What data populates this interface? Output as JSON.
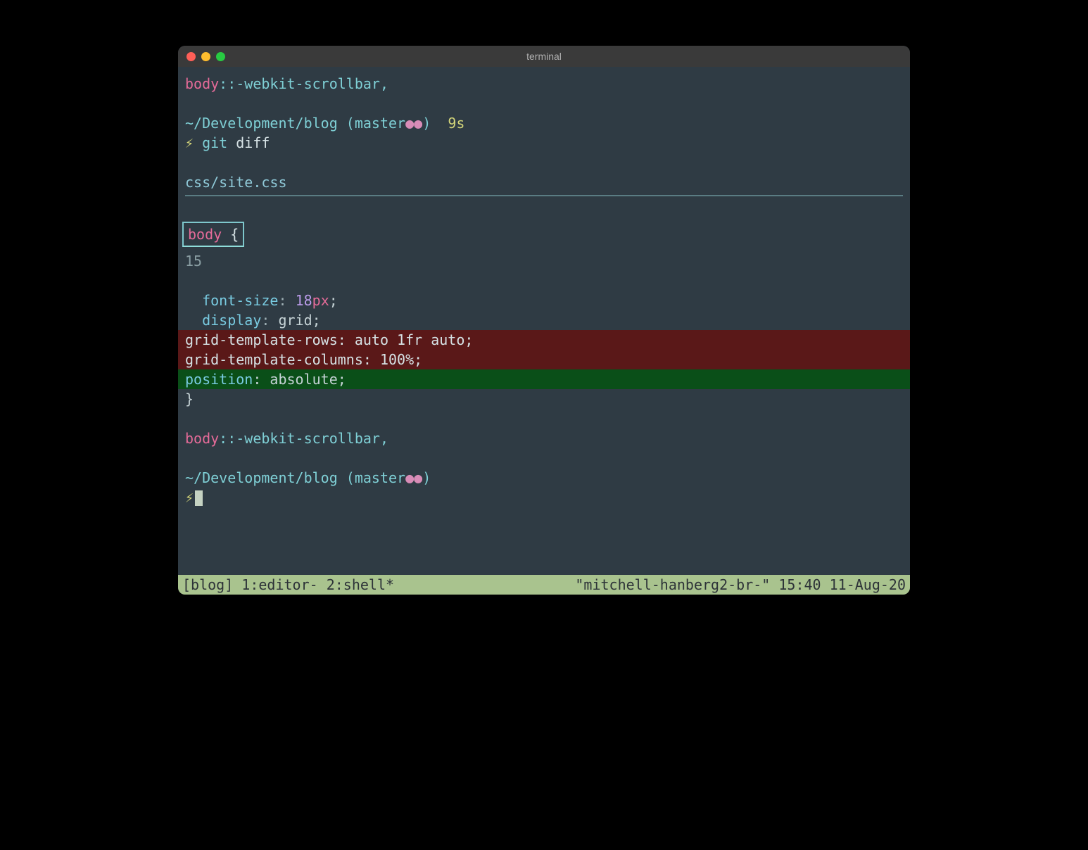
{
  "window": {
    "title": "terminal"
  },
  "output": {
    "line1_a": "body",
    "line1_b": "::-webkit-scrollbar,",
    "prompt_path": "~/Development/blog",
    "prompt_branch_open": " (",
    "prompt_branch": "master",
    "prompt_dots": "●●",
    "prompt_branch_close": ")",
    "prompt_time": "  9s",
    "prompt_sym": "⚡",
    "cmd_git": " git",
    "cmd_diff": " diff",
    "diff_file": "css/site.css",
    "hunk_body": "body ",
    "hunk_brace": "{",
    "line_num": "15",
    "ctx1_prop": "font-size",
    "ctx1_colon": ": ",
    "ctx1_num": "18",
    "ctx1_unit": "px",
    "ctx1_semi": ";",
    "ctx2_prop": "display",
    "ctx2_colon": ": ",
    "ctx2_val": "grid",
    "ctx2_semi": ";",
    "del1": "  grid-template-rows: auto 1fr auto;",
    "del2": "  grid-template-columns: 100%;",
    "add_prop": "position",
    "add_colon": ": ",
    "add_val": "absolute",
    "add_semi": ";",
    "close_brace": "}",
    "line2_a": "body",
    "line2_b": "::-webkit-scrollbar,",
    "prompt2_path": "~/Development/blog",
    "prompt2_branch_open": " (",
    "prompt2_branch": "master",
    "prompt2_dots": "●●",
    "prompt2_branch_close": ")",
    "prompt2_sym": "⚡"
  },
  "statusbar": {
    "left": "[blog] 1:editor- 2:shell*",
    "right": "\"mitchell-hanberg2-br-\" 15:40 11-Aug-20"
  }
}
